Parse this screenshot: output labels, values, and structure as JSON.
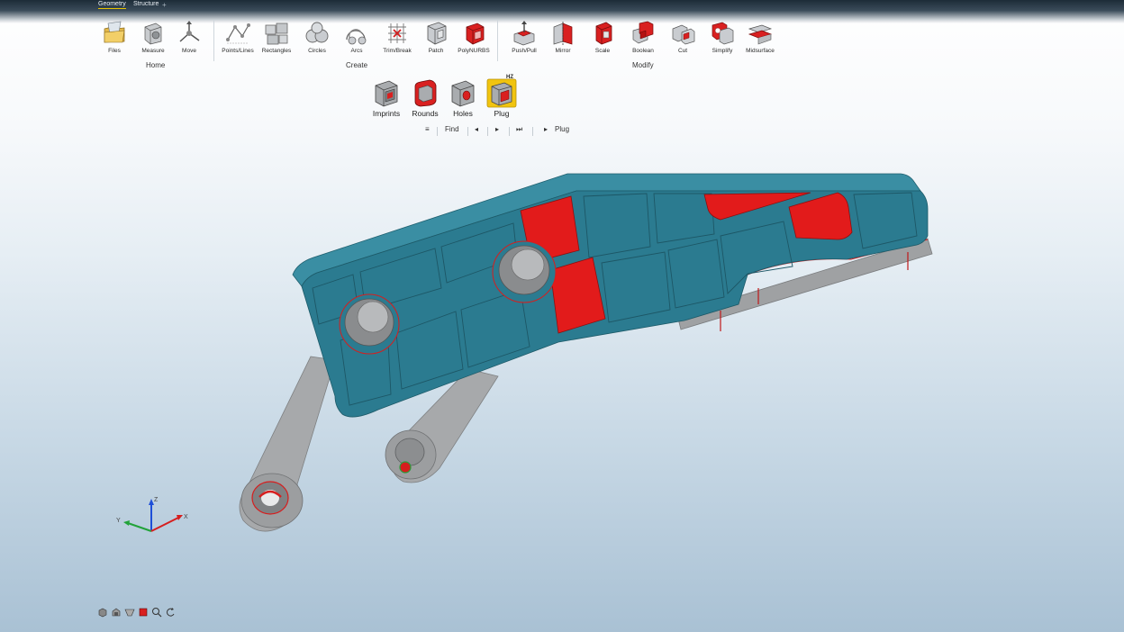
{
  "tabs": [
    {
      "label": "Geometry",
      "active": true
    },
    {
      "label": "Structure",
      "active": false
    }
  ],
  "tab_add_label": "+",
  "ribbon": {
    "home": {
      "label": "Home",
      "buttons": [
        {
          "label": "Files",
          "icon": "folder-icon"
        },
        {
          "label": "Measure",
          "icon": "measure-icon"
        },
        {
          "label": "Move",
          "icon": "move-icon"
        }
      ]
    },
    "create": {
      "label": "Create",
      "buttons": [
        {
          "label": "Points/Lines",
          "icon": "points-lines-icon"
        },
        {
          "label": "Rectangles",
          "icon": "rectangles-icon"
        },
        {
          "label": "Circles",
          "icon": "circles-icon"
        },
        {
          "label": "Arcs",
          "icon": "arcs-icon"
        },
        {
          "label": "Trim/Break",
          "icon": "trim-break-icon"
        },
        {
          "label": "Patch",
          "icon": "patch-icon"
        },
        {
          "label": "PolyNURBS",
          "icon": "polynurbs-icon"
        }
      ]
    },
    "modify": {
      "label": "Modify",
      "buttons": [
        {
          "label": "Push/Pull",
          "icon": "push-pull-icon"
        },
        {
          "label": "Mirror",
          "icon": "mirror-icon"
        },
        {
          "label": "Scale",
          "icon": "scale-icon"
        },
        {
          "label": "Boolean",
          "icon": "boolean-icon"
        },
        {
          "label": "Cut",
          "icon": "cut-icon"
        },
        {
          "label": "Simplify",
          "icon": "simplify-icon"
        },
        {
          "label": "Midsurface",
          "icon": "midsurface-icon"
        }
      ]
    }
  },
  "secondary_tools": [
    {
      "label": "Imprints",
      "icon": "imprints-icon",
      "selected": false
    },
    {
      "label": "Rounds",
      "icon": "rounds-icon",
      "selected": false
    },
    {
      "label": "Holes",
      "icon": "holes-icon",
      "selected": false
    },
    {
      "label": "Plug",
      "icon": "plug-icon",
      "selected": true,
      "badge": "HZ"
    }
  ],
  "find_bar": {
    "menu_glyph": "≡",
    "find_label": "Find",
    "prev_glyph": "◂",
    "next_glyph": "▸",
    "end_glyph": "⏭",
    "run_glyph": "▸",
    "run_label": "Plug"
  },
  "triad": {
    "x_label": "X",
    "y_label": "Y",
    "z_label": "Z"
  },
  "colors": {
    "part_teal": "#2b7b90",
    "highlight_red": "#e21b1b",
    "gray_part": "#a7a9ab",
    "active_tab_underline": "#e8c400",
    "plug_selected": "#f1c40f"
  },
  "bottom_tools": [
    "view-cube-icon",
    "render-icon",
    "section-icon",
    "red-square-icon",
    "zoom-icon",
    "rotate-icon"
  ]
}
